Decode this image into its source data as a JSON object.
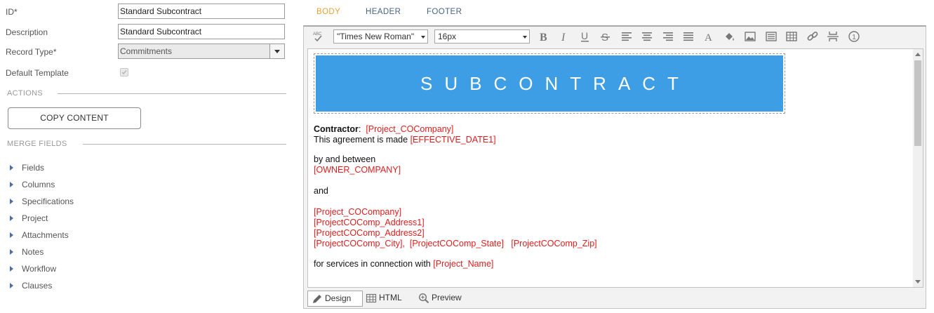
{
  "form": {
    "id_label": "ID*",
    "id_value": "Standard Subcontract",
    "description_label": "Description",
    "description_value": "Standard Subcontract",
    "record_type_label": "Record Type*",
    "record_type_value": "Commitments",
    "default_template_label": "Default Template",
    "default_template_checked": true
  },
  "actions": {
    "section_title": "ACTIONS",
    "copy_content_label": "COPY CONTENT"
  },
  "merge_fields": {
    "section_title": "MERGE FIELDS",
    "items": [
      "Fields",
      "Columns",
      "Specifications",
      "Project",
      "Attachments",
      "Notes",
      "Workflow",
      "Clauses"
    ]
  },
  "editor": {
    "tabs": [
      "BODY",
      "HEADER",
      "FOOTER"
    ],
    "active_tab": "BODY",
    "toolbar": {
      "font_family": "\"Times New Roman\"",
      "font_size": "16px",
      "icons": [
        "spellcheck-icon",
        "bold-icon",
        "italic-icon",
        "underline-icon",
        "strikethrough-icon",
        "align-left-icon",
        "align-center-icon",
        "align-right-icon",
        "align-justify-icon",
        "font-color-icon",
        "fill-color-icon",
        "image-icon",
        "template-icon",
        "table-icon",
        "link-icon",
        "page-break-icon",
        "number-icon"
      ]
    },
    "document": {
      "banner_title": "SUBCONTRACT",
      "banner_color": "#3d9ee5",
      "contractor_label": "Contractor",
      "contractor_field": "[Project_COCompany]",
      "agreement_text": "This agreement is made",
      "effective_date_field": "[EFFECTIVE_DATE1]",
      "by_between_text": "by and between",
      "owner_company_field": "[OWNER_COMPANY]",
      "and_text": "and",
      "co_company_field": "[Project_COCompany]",
      "address1_field": "[ProjectCOComp_Address1]",
      "address2_field": "[ProjectCOComp_Address2]",
      "city_field": "[ProjectCOComp_City]",
      "state_field": "[ProjectCOComp_State]",
      "zip_field": "[ProjectCOComp_Zip]",
      "services_text": "for services in connection with",
      "project_name_field": "[Project_Name]",
      "merge_field_color": "#e21c1c"
    },
    "bottom_tabs": [
      "Design",
      "HTML",
      "Preview"
    ],
    "active_bottom_tab": "Design"
  }
}
